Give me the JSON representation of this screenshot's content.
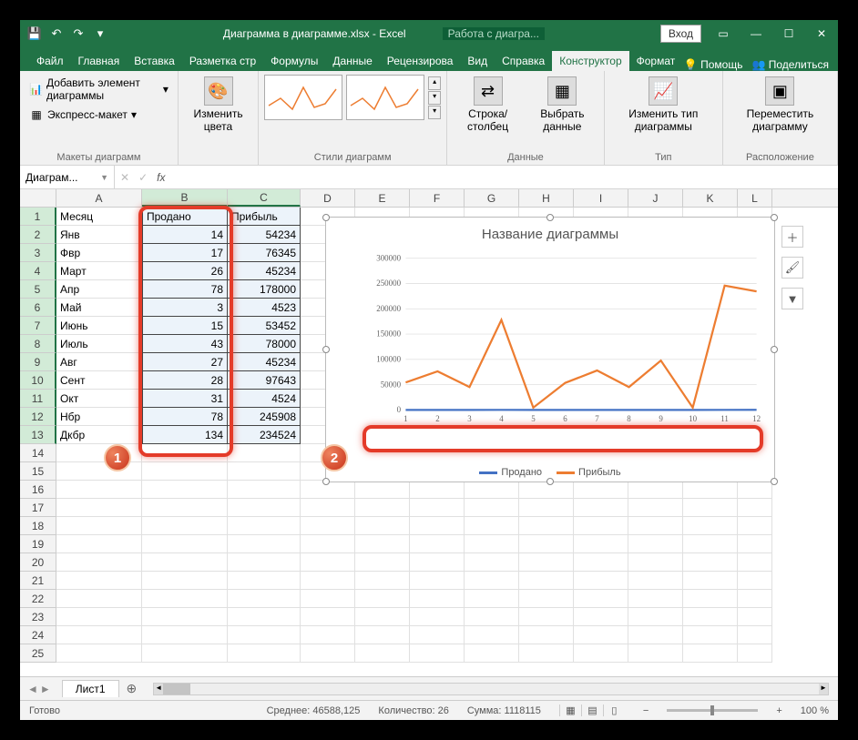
{
  "title": {
    "filename": "Диаграмма в диаграмме.xlsx - Excel",
    "context": "Работа с диагра...",
    "login": "Вход"
  },
  "tabs": [
    "Файл",
    "Главная",
    "Вставка",
    "Разметка стр",
    "Формулы",
    "Данные",
    "Рецензирова",
    "Вид",
    "Справка",
    "Конструктор",
    "Формат"
  ],
  "active_tab": 9,
  "ribbon": {
    "g1_add": "Добавить элемент диаграммы",
    "g1_express": "Экспресс-макет",
    "g1_label": "Макеты диаграмм",
    "g2_colors": "Изменить цвета",
    "g2_label": "Стили диаграмм",
    "g3_row": "Строка/ столбец",
    "g3_select": "Выбрать данные",
    "g3_label": "Данные",
    "g4_change": "Изменить тип диаграммы",
    "g4_label": "Тип",
    "g5_move": "Переместить диаграмму",
    "g5_label": "Расположение",
    "help": "Помощь",
    "share": "Поделиться"
  },
  "name_box": "Диаграм...",
  "fx": "fx",
  "columns": [
    "A",
    "B",
    "C",
    "D",
    "E",
    "F",
    "G",
    "H",
    "I",
    "J",
    "K",
    "L"
  ],
  "table": {
    "headers": [
      "Месяц",
      "Продано",
      "Прибыль"
    ],
    "rows": [
      [
        "Янв",
        "14",
        "54234"
      ],
      [
        "Фвр",
        "17",
        "76345"
      ],
      [
        "Март",
        "26",
        "45234"
      ],
      [
        "Апр",
        "78",
        "178000"
      ],
      [
        "Май",
        "3",
        "4523"
      ],
      [
        "Июнь",
        "15",
        "53452"
      ],
      [
        "Июль",
        "43",
        "78000"
      ],
      [
        "Авг",
        "27",
        "45234"
      ],
      [
        "Сент",
        "28",
        "97643"
      ],
      [
        "Окт",
        "31",
        "4524"
      ],
      [
        "Нбр",
        "78",
        "245908"
      ],
      [
        "Дкбр",
        "134",
        "234524"
      ]
    ]
  },
  "chart": {
    "title": "Название диаграммы",
    "legend": [
      "Продано",
      "Прибыль"
    ]
  },
  "chart_data": {
    "type": "line",
    "title": "Название диаграммы",
    "x": [
      1,
      2,
      3,
      4,
      5,
      6,
      7,
      8,
      9,
      10,
      11,
      12
    ],
    "ylim": [
      0,
      300000
    ],
    "yticks": [
      0,
      50000,
      100000,
      150000,
      200000,
      250000,
      300000
    ],
    "series": [
      {
        "name": "Продано",
        "color": "#4472c4",
        "values": [
          14,
          17,
          26,
          78,
          3,
          15,
          43,
          27,
          28,
          31,
          78,
          134
        ]
      },
      {
        "name": "Прибыль",
        "color": "#ed7d31",
        "values": [
          54234,
          76345,
          45234,
          178000,
          4523,
          53452,
          78000,
          45234,
          97643,
          4524,
          245908,
          234524
        ]
      }
    ]
  },
  "callouts": {
    "one": "1",
    "two": "2"
  },
  "sheet": "Лист1",
  "status": {
    "avg_lbl": "Среднее:",
    "avg": "46588,125",
    "count_lbl": "Количество:",
    "count": "26",
    "sum_lbl": "Сумма:",
    "sum": "1118115",
    "zoom": "100 %"
  },
  "ready": "Готово"
}
